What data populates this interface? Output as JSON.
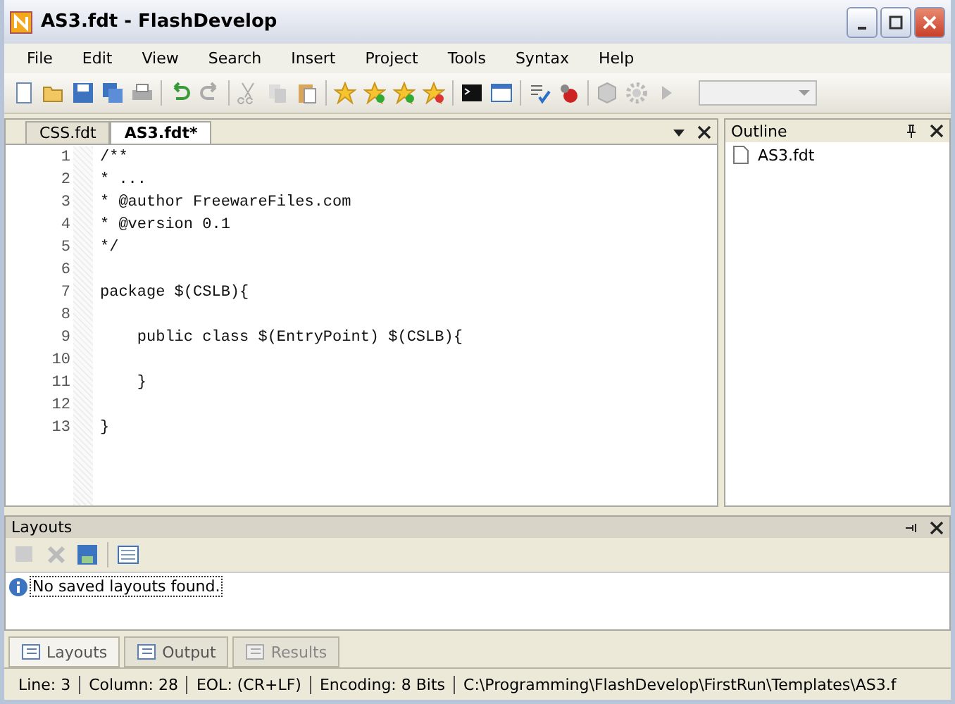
{
  "window": {
    "title": "AS3.fdt - FlashDevelop"
  },
  "menu": [
    "File",
    "Edit",
    "View",
    "Search",
    "Insert",
    "Project",
    "Tools",
    "Syntax",
    "Help"
  ],
  "editor_tabs": [
    {
      "label": "CSS.fdt",
      "selected": false
    },
    {
      "label": "AS3.fdt*",
      "selected": true
    }
  ],
  "code_lines": [
    {
      "number": "1",
      "text": "/**"
    },
    {
      "number": "2",
      "text": "* ..."
    },
    {
      "number": "3",
      "text": "* @author FreewareFiles.com"
    },
    {
      "number": "4",
      "text": "* @version 0.1"
    },
    {
      "number": "5",
      "text": "*/"
    },
    {
      "number": "6"
    },
    {
      "number": "7",
      "text": "package $(CSLB){"
    },
    {
      "number": "8"
    },
    {
      "number": "9",
      "text": "    public class $(EntryPoint) $(CSLB){"
    },
    {
      "number": "10"
    },
    {
      "number": "11",
      "text": "    }"
    },
    {
      "number": "12"
    },
    {
      "number": "13",
      "text": "}"
    }
  ],
  "outline": {
    "title": "Outline",
    "items": [
      "AS3.fdt"
    ]
  },
  "layouts_panel": {
    "title": "Layouts",
    "message": "No saved layouts found."
  },
  "bottom_tabs": [
    {
      "label": "Layouts",
      "selected": true,
      "disabled": false
    },
    {
      "label": "Output",
      "selected": false,
      "disabled": false
    },
    {
      "label": "Results",
      "selected": false,
      "disabled": true
    }
  ],
  "status_bar": [
    "Line: 3",
    "Column: 28",
    "EOL: (CR+LF)",
    "Encoding: 8 Bits",
    "C:\\Programming\\FlashDevelop\\FirstRun\\Templates\\AS3.f"
  ]
}
